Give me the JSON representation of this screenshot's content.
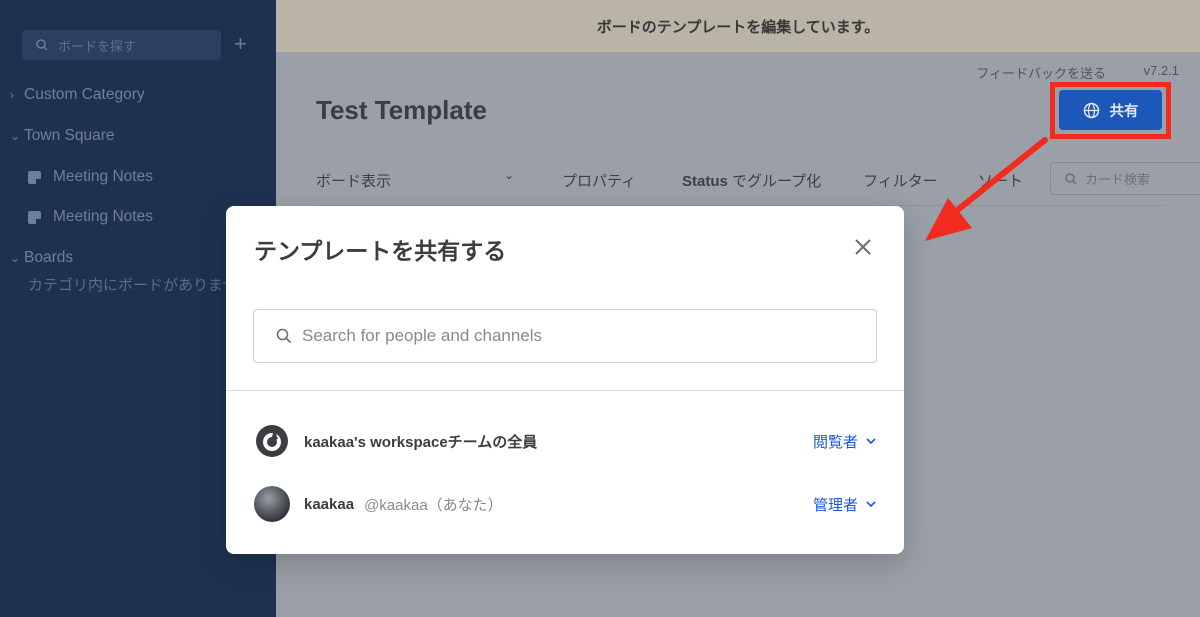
{
  "sidebar": {
    "search_placeholder": "ボードを探す",
    "add_icon": "+",
    "items": [
      {
        "label": "Custom Category"
      },
      {
        "label": "Town Square"
      },
      {
        "label": "Meeting Notes"
      },
      {
        "label": "Meeting Notes"
      },
      {
        "label": "Boards"
      }
    ],
    "empty_message": "カテゴリ内にボードがありません"
  },
  "banner": {
    "text": "ボードのテンプレートを編集しています。"
  },
  "header": {
    "feedback_label": "フィードバックを送る",
    "version": "v7.2.1",
    "board_title": "Test Template",
    "share_label": "共有"
  },
  "toolbar": {
    "view_label": "ボード表示",
    "properties_label": "プロパティ",
    "group_prefix": "Status",
    "group_suffix": "でグループ化",
    "filter_label": "フィルター",
    "sort_label": "ソート",
    "search_placeholder": "カード検索"
  },
  "modal": {
    "title": "テンプレートを共有する",
    "search_placeholder": "Search for people and channels",
    "members": [
      {
        "name": "kaakaa's workspaceチームの全員",
        "handle": "",
        "role": "閲覧者",
        "avatar": "mattermost-logo-icon"
      },
      {
        "name": "kaakaa",
        "handle": "@kaakaa（あなた）",
        "role": "管理者",
        "avatar": "user-photo"
      }
    ]
  },
  "colors": {
    "sidebar_bg": "#1e3250",
    "banner_bg": "#b9b4a5",
    "share_button": "#1c58b9",
    "highlight": "#f22a1f",
    "role_link": "#1c58d9"
  }
}
